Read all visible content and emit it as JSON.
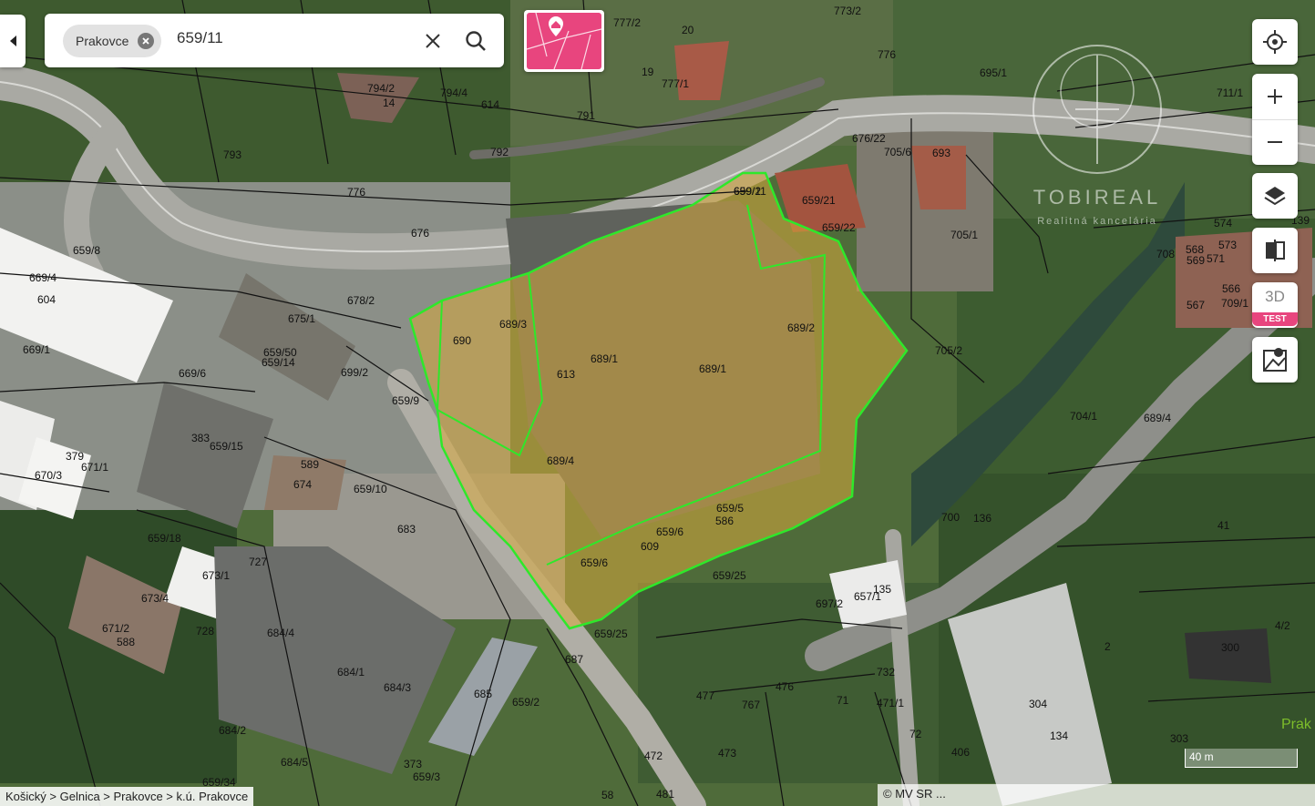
{
  "search": {
    "chip_label": "Prakovce",
    "query": "659/11"
  },
  "controls": {
    "three_d": "3D",
    "test_badge": "TEST"
  },
  "map": {
    "watermark_brand": "TOBIREAL",
    "watermark_tagline": "Realitná kancelária",
    "breadcrumb": "Košický > Gelnica > Prakovce > k.ú. Prakovce",
    "attribution": "© MV SR ...",
    "scale": "40 m",
    "place_label": "Prak",
    "parcels": [
      "659/11",
      "659/21",
      "659/22",
      "689/3",
      "689/1",
      "689/1",
      "689/2",
      "689/4",
      "690",
      "659/5",
      "586",
      "659/6",
      "609",
      "659/6",
      "659/25",
      "659/25",
      "659/9",
      "659/10",
      "659/15",
      "659/14",
      "659/50",
      "675/1",
      "678/2",
      "676",
      "776",
      "776",
      "793",
      "792",
      "791",
      "794/2",
      "794/4",
      "614",
      "14",
      "19",
      "20",
      "777/1",
      "777/2",
      "773/2",
      "695/1",
      "711/1",
      "705/6",
      "693",
      "705/1",
      "705/2",
      "704/1",
      "669/4",
      "604",
      "669/1",
      "669/6",
      "659/8",
      "670/3",
      "671/1",
      "379",
      "383",
      "589",
      "674",
      "683",
      "659/18",
      "673/1",
      "727",
      "673/4",
      "671/2",
      "588",
      "728",
      "684/4",
      "684/1",
      "684/3",
      "684/2",
      "684/5",
      "685",
      "659/2",
      "687",
      "697/2",
      "657/1",
      "135",
      "476",
      "477",
      "732",
      "71",
      "471/1",
      "72",
      "304",
      "134",
      "406",
      "300",
      "303",
      "4/2",
      "2",
      "41",
      "700",
      "136",
      "574",
      "573",
      "568",
      "569",
      "571",
      "567",
      "566",
      "709/1",
      "708",
      "139",
      "676/22",
      "373",
      "659/3",
      "659/34",
      "472",
      "473",
      "767",
      "481",
      "58",
      "699/2",
      "613",
      "689/4",
      "699/2"
    ]
  }
}
